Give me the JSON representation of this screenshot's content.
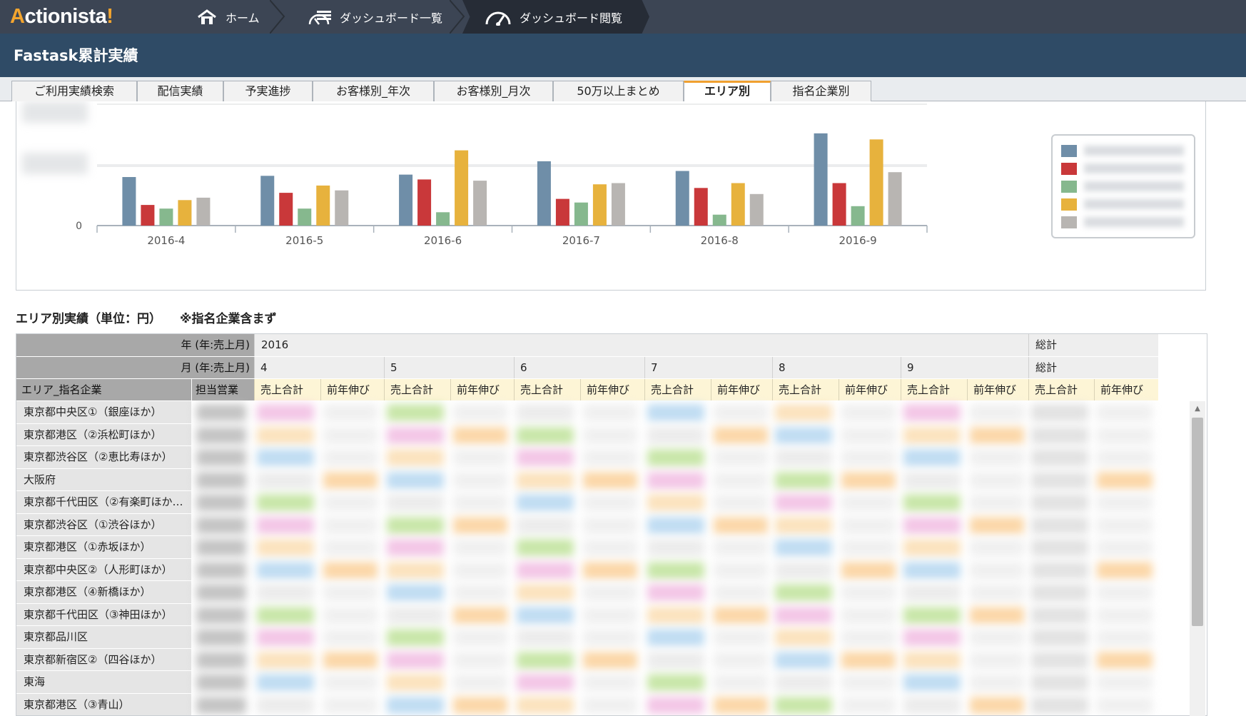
{
  "app": {
    "logo_first": "A",
    "logo_middle": "ctionista",
    "logo_last": "!",
    "logo_accent": "#f3a52f"
  },
  "breadcrumb": [
    {
      "label": "ホーム",
      "icon": "home-icon"
    },
    {
      "label": "ダッシュボード一覧",
      "icon": "dashboard-list-icon"
    },
    {
      "label": "ダッシュボード閲覧",
      "icon": "gauge-icon"
    }
  ],
  "page": {
    "title": "Fastask累計実績"
  },
  "tabs": [
    {
      "label": "ご利用実績検索"
    },
    {
      "label": "配信実績"
    },
    {
      "label": "予実進捗"
    },
    {
      "label": "お客様別_年次"
    },
    {
      "label": "お客様別_月次"
    },
    {
      "label": "50万以上まとめ"
    },
    {
      "label": "エリア別",
      "active": true
    },
    {
      "label": "指名企業別"
    }
  ],
  "chart_data": {
    "type": "bar",
    "categories": [
      "2016-4",
      "2016-5",
      "2016-6",
      "2016-7",
      "2016-8",
      "2016-9"
    ],
    "ytick_label": "0",
    "ylim": [
      0,
      100
    ],
    "grid": true,
    "legend_position": "right",
    "series": [
      {
        "color": "#6f8ea8",
        "values": [
          40,
          41,
          42,
          53,
          45,
          76
        ]
      },
      {
        "color": "#c9383a",
        "values": [
          17,
          27,
          38,
          22,
          31,
          35
        ]
      },
      {
        "color": "#86b88e",
        "values": [
          14,
          14,
          11,
          19,
          9,
          16
        ]
      },
      {
        "color": "#e7b23d",
        "values": [
          21,
          33,
          62,
          34,
          35,
          71
        ]
      },
      {
        "color": "#b8b5b2",
        "values": [
          23,
          29,
          37,
          35,
          26,
          44
        ]
      }
    ]
  },
  "section": {
    "title": "エリア別実績（単位：円）",
    "note": "※指名企業含まず"
  },
  "table": {
    "year_label": "年 (年:売上月)",
    "year_value": "2016",
    "month_label": "月 (年:売上月)",
    "months": [
      "4",
      "5",
      "6",
      "7",
      "8",
      "9"
    ],
    "grand_total": "総計",
    "col_area": "エリア_指名企業",
    "col_sales_rep": "担当営業",
    "col_sales_total": "売上合計",
    "col_yoy": "前年伸び",
    "rows": [
      "東京都中央区①（銀座ほか）",
      "東京都港区（②浜松町ほか）",
      "東京都渋谷区（②恵比寿ほか）",
      "大阪府",
      "東京都千代田区（②有楽町ほか…",
      "東京都渋谷区（①渋谷ほか）",
      "東京都港区（①赤坂ほか）",
      "東京都中央区②（人形町ほか）",
      "東京都港区（④新橋ほか）",
      "東京都千代田区（③神田ほか）",
      "東京都品川区",
      "東京都新宿区②（四谷ほか）",
      "東海",
      "東京都港区（③青山）"
    ]
  }
}
